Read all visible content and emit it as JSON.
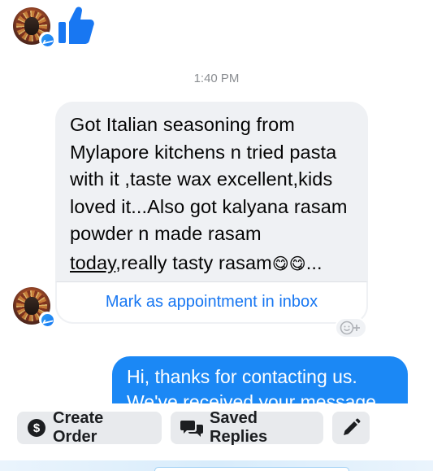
{
  "conversation": {
    "timestamp": "1:40 PM",
    "incoming_message": {
      "lines": [
        "Got Italian seasoning from",
        "Mylapore kitchens n tried pasta",
        "with it ,taste wax excellent,kids",
        "loved it...Also got kalyana rasam",
        "powder n made rasam"
      ],
      "last_line_link": "today",
      "last_line_rest": ",really tasty rasam",
      "last_line_emoji": "😋😋",
      "ellipsis": "..."
    },
    "mark_action": "Mark as appointment in inbox",
    "outgoing_message": {
      "line1": "Hi, thanks for contacting us.",
      "line2": "We've received your message"
    }
  },
  "toolbar": {
    "create_order": "Create Order",
    "saved_replies": "Saved Replies"
  },
  "icons": {
    "like": "thumbs-up-icon",
    "messenger_badge": "messenger-icon",
    "dollar": "dollar-icon",
    "chat": "chat-bubbles-icon",
    "edit": "pencil-icon",
    "reaction": "add-reaction-icon"
  },
  "colors": {
    "accent": "#1877f2",
    "outgoing_bubble": "#1b88f5",
    "incoming_bubble": "#eff1f4"
  }
}
